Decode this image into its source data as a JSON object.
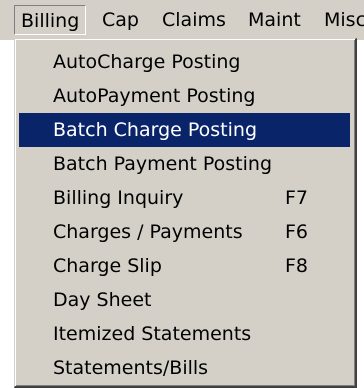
{
  "menubar": {
    "items": [
      {
        "label": "Billing",
        "active": true
      },
      {
        "label": "Cap",
        "active": false
      },
      {
        "label": "Claims",
        "active": false
      },
      {
        "label": "Maint",
        "active": false
      },
      {
        "label": "Misc",
        "active": false
      }
    ]
  },
  "billing_menu": {
    "items": [
      {
        "label": "AutoCharge Posting",
        "shortcut": ""
      },
      {
        "label": "AutoPayment Posting",
        "shortcut": ""
      },
      {
        "label": "Batch Charge Posting",
        "shortcut": "",
        "highlighted": true
      },
      {
        "label": "Batch Payment Posting",
        "shortcut": ""
      },
      {
        "label": "Billing Inquiry",
        "shortcut": "F7"
      },
      {
        "label": "Charges / Payments",
        "shortcut": "F6"
      },
      {
        "label": "Charge Slip",
        "shortcut": "F8"
      },
      {
        "label": "Day Sheet",
        "shortcut": ""
      },
      {
        "label": "Itemized Statements",
        "shortcut": ""
      },
      {
        "label": "Statements/Bills",
        "shortcut": ""
      }
    ]
  },
  "colors": {
    "menu_background": "#d4d0c8",
    "highlight_background": "#0a246a",
    "highlight_text": "#ffffff"
  }
}
